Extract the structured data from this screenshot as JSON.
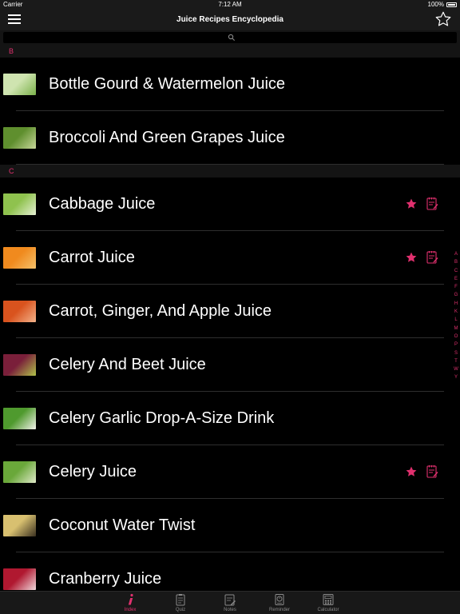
{
  "status": {
    "carrier": "Carrier",
    "time": "7:12 AM",
    "battery": "100%"
  },
  "nav": {
    "title": "Juice Recipes Encyclopedia"
  },
  "colors": {
    "accent": "#e0306e",
    "background": "#000000",
    "bar": "#1a1a1a"
  },
  "sections": [
    {
      "letter": "B",
      "rows": [
        {
          "label": "Bottle Gourd & Watermelon Juice",
          "favorite": false,
          "note": false,
          "thumb": [
            "#cfe4b0",
            "#7ab04a"
          ]
        },
        {
          "label": "Broccoli And Green Grapes Juice",
          "favorite": false,
          "note": false,
          "thumb": [
            "#5f8f2e",
            "#c8d89a"
          ]
        }
      ]
    },
    {
      "letter": "C",
      "rows": [
        {
          "label": "Cabbage Juice",
          "favorite": true,
          "note": true,
          "thumb": [
            "#8fc24e",
            "#e6f0d4"
          ]
        },
        {
          "label": "Carrot Juice",
          "favorite": true,
          "note": true,
          "thumb": [
            "#f08a1e",
            "#f5c26b"
          ]
        },
        {
          "label": "Carrot, Ginger, And Apple Juice",
          "favorite": false,
          "note": false,
          "thumb": [
            "#d9531e",
            "#f3b28a"
          ]
        },
        {
          "label": "Celery And Beet Juice",
          "favorite": false,
          "note": false,
          "thumb": [
            "#7a1f3a",
            "#b0c24a"
          ]
        },
        {
          "label": "Celery Garlic Drop-A-Size Drink",
          "favorite": false,
          "note": false,
          "thumb": [
            "#4f9a2e",
            "#f2f2ea"
          ]
        },
        {
          "label": "Celery Juice",
          "favorite": true,
          "note": true,
          "thumb": [
            "#6aa83a",
            "#dfe9c8"
          ]
        },
        {
          "label": "Coconut Water Twist",
          "favorite": false,
          "note": false,
          "thumb": [
            "#d8c070",
            "#3a3020"
          ]
        },
        {
          "label": "Cranberry Juice",
          "favorite": false,
          "note": false,
          "thumb": [
            "#b01830",
            "#f0d8dc"
          ]
        }
      ]
    }
  ],
  "index_letters": [
    "A",
    "B",
    "C",
    "E",
    "F",
    "G",
    "H",
    "K",
    "L",
    "M",
    "O",
    "P",
    "S",
    "T",
    "W",
    "Y"
  ],
  "tabs": [
    {
      "label": "Index",
      "icon": "info-icon",
      "active": true
    },
    {
      "label": "Quiz",
      "icon": "quiz-icon",
      "active": false
    },
    {
      "label": "Notes",
      "icon": "notes-icon",
      "active": false
    },
    {
      "label": "Reminder",
      "icon": "reminder-icon",
      "active": false
    },
    {
      "label": "Calculator",
      "icon": "calculator-icon",
      "active": false
    }
  ]
}
